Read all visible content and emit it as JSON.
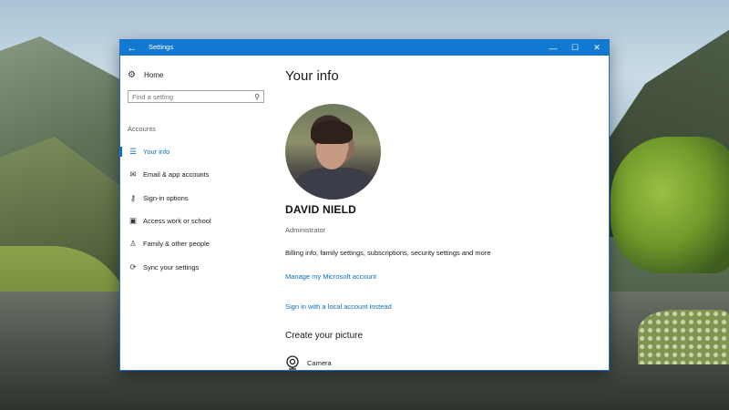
{
  "window": {
    "title": "Settings",
    "back_icon": "arrow-left-icon",
    "controls": {
      "minimize": "—",
      "maximize": "☐",
      "close": "✕"
    },
    "accent": "#1279d3"
  },
  "nav": {
    "home": {
      "icon": "gear-icon",
      "label": "Home"
    },
    "search": {
      "placeholder": "Find a setting",
      "icon": "search-icon"
    },
    "section": "Accounts",
    "items": [
      {
        "icon": "person-card-icon",
        "label": "Your info",
        "active": true
      },
      {
        "icon": "mail-icon",
        "label": "Email & app accounts"
      },
      {
        "icon": "key-icon",
        "label": "Sign-in options"
      },
      {
        "icon": "briefcase-icon",
        "label": "Access work or school"
      },
      {
        "icon": "person-icon",
        "label": "Family & other people"
      },
      {
        "icon": "sync-icon",
        "label": "Sync your settings"
      }
    ]
  },
  "content": {
    "title": "Your info",
    "user_name": "DAVID NIELD",
    "user_role": "Administrator",
    "billing_text": "Billing info, family settings, subscriptions, security settings and more",
    "manage_link": "Manage my Microsoft account",
    "local_link": "Sign in with a local account instead",
    "picture_section": "Create your picture",
    "camera": {
      "icon": "camera-icon",
      "label": "Camera"
    }
  },
  "colors": {
    "link": "#0a6fc2",
    "text": "#1a1a1a",
    "muted": "#5e5e5e"
  }
}
